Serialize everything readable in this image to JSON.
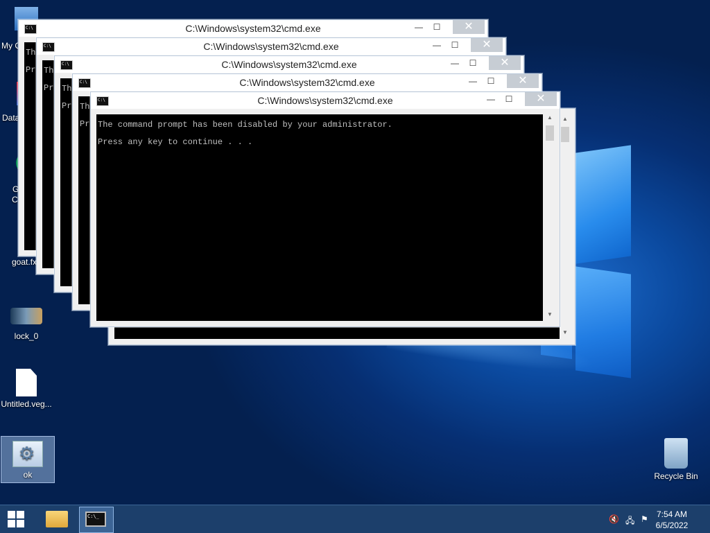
{
  "desktop": {
    "icons": [
      {
        "label": "My C"
      },
      {
        "label": "Data"
      },
      {
        "label": "G"
      },
      {
        "label": "C"
      },
      {
        "label": "goat.fx"
      },
      {
        "label": "lock_0"
      },
      {
        "label": "Untitled.veg..."
      },
      {
        "label": "ok"
      },
      {
        "label": "Recycle Bin"
      }
    ]
  },
  "cmd_windows": [
    {
      "title": "C:\\Windows\\system32\\cmd.exe",
      "line1": "Th",
      "line2": "Pr"
    },
    {
      "title": "C:\\Windows\\system32\\cmd.exe",
      "line1": "Th",
      "line2": "Pr"
    },
    {
      "title": "C:\\Windows\\system32\\cmd.exe",
      "line1": "Th",
      "line2": "Pr"
    },
    {
      "title": "C:\\Windows\\system32\\cmd.exe",
      "line1": "Th",
      "line2": "Pr"
    },
    {
      "title": "C:\\Windows\\system32\\cmd.exe",
      "line1": "The command prompt has been disabled by your administrator.",
      "line2": "Press any key to continue . . ."
    }
  ],
  "window_buttons": {
    "minimize": "—",
    "maximize": "☐",
    "close": "✕"
  },
  "taskbar": {
    "start_icon": "windows-logo-icon",
    "pinned": [
      "file-explorer-icon",
      "cmd-icon"
    ],
    "cmd_icon_text": "C:\\_",
    "tray": [
      "volume-muted-icon",
      "network-icon",
      "action-center-icon"
    ],
    "time": "7:54 AM",
    "date": "6/5/2022"
  }
}
